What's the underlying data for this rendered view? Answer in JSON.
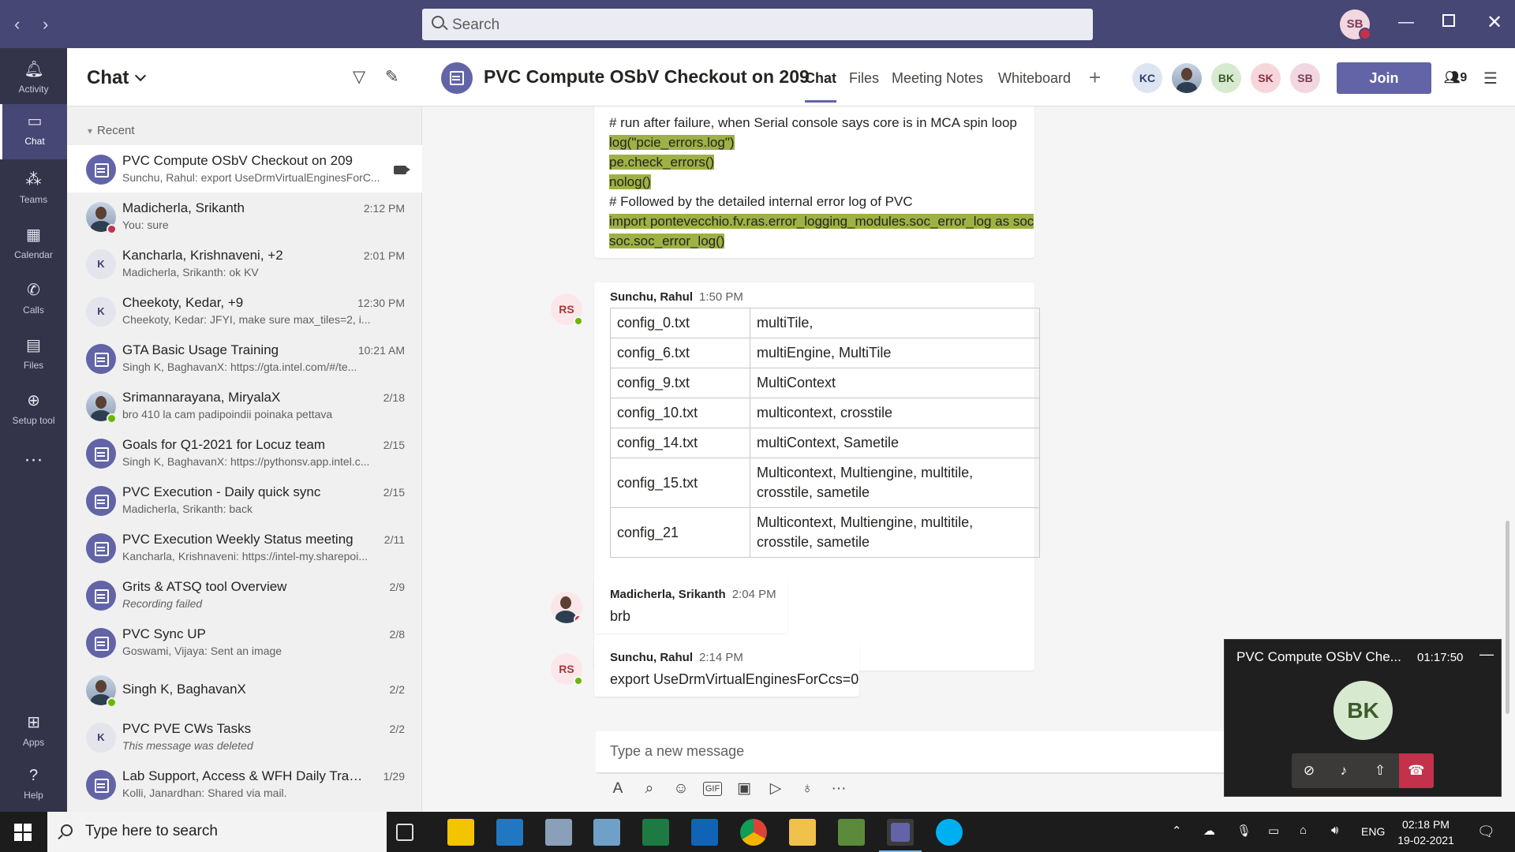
{
  "search": {
    "placeholder": "Search"
  },
  "me": {
    "initials": "SB"
  },
  "rail": [
    {
      "label": "Activity",
      "icon": "bell-icon"
    },
    {
      "label": "Chat",
      "icon": "chat-icon"
    },
    {
      "label": "Teams",
      "icon": "teams-icon"
    },
    {
      "label": "Calendar",
      "icon": "calendar-icon"
    },
    {
      "label": "Calls",
      "icon": "phone-icon"
    },
    {
      "label": "Files",
      "icon": "files-icon"
    },
    {
      "label": "Setup tool",
      "icon": "plus-circle-icon"
    },
    {
      "label": "Apps",
      "icon": "apps-icon"
    },
    {
      "label": "Help",
      "icon": "help-icon"
    }
  ],
  "chatlist": {
    "title": "Chat",
    "section": "Recent",
    "items": [
      {
        "name": "PVC Compute OSbV Checkout on 209",
        "preview": "Sunchu, Rahul: export UseDrmVirtualEnginesForC...",
        "time": ""
      },
      {
        "name": "Madicherla, Srikanth",
        "preview": "You: sure",
        "time": "2:12 PM"
      },
      {
        "name": "Kancharla, Krishnaveni, +2",
        "preview": "Madicherla, Srikanth: ok KV",
        "time": "2:01 PM"
      },
      {
        "name": "Cheekoty, Kedar, +9",
        "preview": "Cheekoty, Kedar: JFYI, make sure max_tiles=2, i...",
        "time": "12:30 PM"
      },
      {
        "name": "GTA Basic Usage Training",
        "preview": "Singh K, BaghavanX: https://gta.intel.com/#/te...",
        "time": "10:21 AM"
      },
      {
        "name": "Srimannarayana, MiryalaX",
        "preview": "bro 410 la cam padipoindii poinaka pettava",
        "time": "2/18"
      },
      {
        "name": "Goals for Q1-2021 for Locuz team",
        "preview": "Singh K, BaghavanX: https://pythonsv.app.intel.c...",
        "time": "2/15"
      },
      {
        "name": "PVC Execution - Daily quick sync",
        "preview": "Madicherla, Srikanth: back",
        "time": "2/15"
      },
      {
        "name": "PVC Execution Weekly Status meeting",
        "preview": "Kancharla, Krishnaveni: https://intel-my.sharepoi...",
        "time": "2/11"
      },
      {
        "name": "Grits & ATSQ tool Overview",
        "preview": "Recording failed",
        "time": "2/9"
      },
      {
        "name": "PVC Sync UP",
        "preview": "Goswami, Vijaya: Sent an image",
        "time": "2/8"
      },
      {
        "name": "Singh K, BaghavanX",
        "preview": "",
        "time": "2/2"
      },
      {
        "name": "PVC PVE CWs Tasks",
        "preview": "This message was deleted",
        "time": "2/2"
      },
      {
        "name": "Lab Support, Access & WFH Daily Track...",
        "preview": "Kolli, Janardhan: Shared via mail.",
        "time": "1/29"
      }
    ]
  },
  "conversation": {
    "title": "PVC Compute OSbV Checkout on 209",
    "tabs": [
      "Chat",
      "Files",
      "Meeting Notes",
      "Whiteboard"
    ],
    "participants": [
      "KC",
      "",
      "BK",
      "SK",
      "SB"
    ],
    "join_label": "Join",
    "participant_count": "9"
  },
  "messages": {
    "code": [
      {
        "text": "# run after failure, when Serial console says core is in MCA spin loop",
        "hl": false
      },
      {
        "text": "log(\"pcie_errors.log\")",
        "hl": true
      },
      {
        "text": "pe.check_errors()",
        "hl": true
      },
      {
        "text": "nolog()",
        "hl": true
      },
      {
        "text": "# Followed by the detailed internal error log of PVC",
        "hl": false
      },
      {
        "text": "import pontevecchio.fv.ras.error_logging_modules.soc_error_log as soc",
        "hl": true
      },
      {
        "text": "soc.soc_error_log()",
        "hl": true
      }
    ],
    "table_msg": {
      "initials": "RS",
      "author": "Sunchu, Rahul",
      "time": "1:50 PM",
      "rows": [
        [
          "config_0.txt",
          "multiTile,"
        ],
        [
          "config_6.txt",
          "multiEngine, MultiTile"
        ],
        [
          "config_9.txt",
          "MultiContext"
        ],
        [
          "config_10.txt",
          "multicontext, crosstile"
        ],
        [
          "config_14.txt",
          "multiContext, Sametile"
        ],
        [
          "config_15.txt",
          "Multicontext, Multiengine, multitile, crosstile, sametile"
        ],
        [
          "config_21",
          "Multicontext, Multiengine, multitile, crosstile, sametile"
        ]
      ]
    },
    "brb_msg": {
      "author": "Madicherla, Srikanth",
      "time": "2:04 PM",
      "text": "brb"
    },
    "export_msg": {
      "initials": "RS",
      "author": "Sunchu, Rahul",
      "time": "2:14 PM",
      "text": "export UseDrmVirtualEnginesForCcs=0"
    }
  },
  "compose": {
    "placeholder": "Type a new message"
  },
  "mini_call": {
    "title": "PVC Compute OSbV Che...",
    "timer": "01:17:50",
    "initials": "BK"
  },
  "taskbar": {
    "search_placeholder": "Type here to search",
    "language": "ENG",
    "time": "02:18 PM",
    "date": "19-02-2021"
  },
  "colors": {
    "brand": "#6264a7",
    "titlebar": "#464775",
    "rail": "#33344a",
    "highlight": "#9eb144",
    "busy": "#c4314b",
    "available": "#6bb700"
  }
}
